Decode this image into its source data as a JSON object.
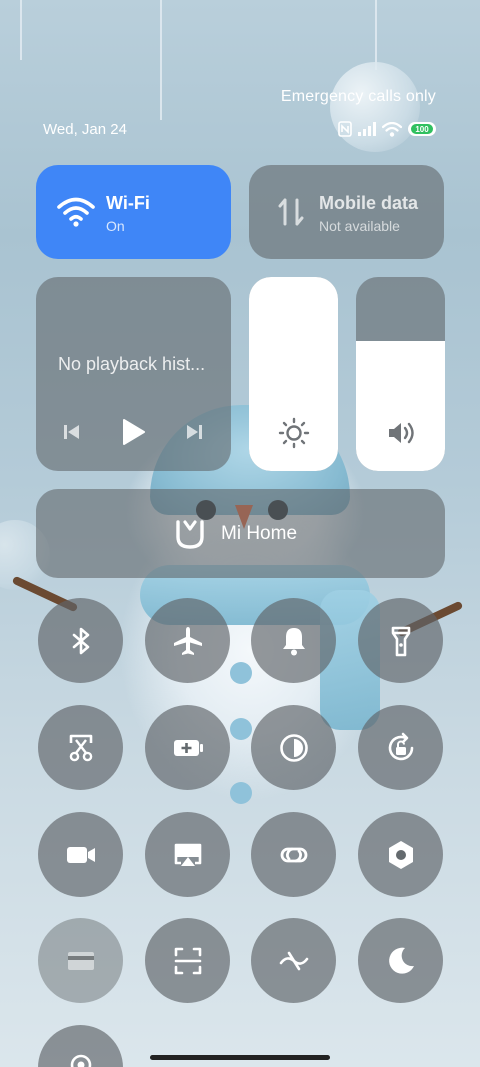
{
  "status_bar": {
    "emergency_text": "Emergency calls only",
    "date": "Wed, Jan 24",
    "battery_level": "100"
  },
  "tiles": {
    "wifi": {
      "title": "Wi-Fi",
      "status": "On",
      "active": true,
      "accent": "#3f86f7"
    },
    "mobile_data": {
      "title": "Mobile data",
      "status": "Not available",
      "active": false
    }
  },
  "media": {
    "text": "No playback hist..."
  },
  "sliders": {
    "brightness": {
      "level": 1.0,
      "icon": "sun-icon"
    },
    "volume": {
      "level": 0.67,
      "icon": "speaker-icon"
    }
  },
  "mi_home": {
    "label": "Mi Home"
  },
  "toggles": [
    {
      "name": "bluetooth",
      "icon": "bluetooth-icon"
    },
    {
      "name": "airplane-mode",
      "icon": "airplane-icon"
    },
    {
      "name": "sound",
      "icon": "bell-icon"
    },
    {
      "name": "flashlight",
      "icon": "flashlight-icon"
    },
    {
      "name": "screenshot",
      "icon": "scissors-screenshot-icon"
    },
    {
      "name": "battery-saver",
      "icon": "battery-plus-icon"
    },
    {
      "name": "dark-mode",
      "icon": "contrast-icon"
    },
    {
      "name": "rotation-lock",
      "icon": "rotate-lock-icon"
    },
    {
      "name": "screen-recorder",
      "icon": "video-camera-icon"
    },
    {
      "name": "cast",
      "icon": "cast-icon"
    },
    {
      "name": "link",
      "icon": "link-icon"
    },
    {
      "name": "settings",
      "icon": "hexagon-nut-icon"
    },
    {
      "name": "card",
      "icon": "card-icon",
      "disabled": true
    },
    {
      "name": "scanner",
      "icon": "scan-icon"
    },
    {
      "name": "reading-mode",
      "icon": "wave-off-icon"
    },
    {
      "name": "do-not-disturb",
      "icon": "moon-icon"
    },
    {
      "name": "location",
      "icon": "location-icon"
    }
  ]
}
